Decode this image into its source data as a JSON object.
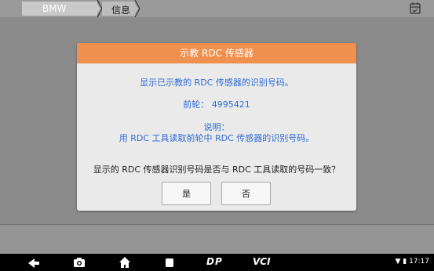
{
  "topbar": {
    "breadcrumb": [
      "BMW",
      "信息"
    ]
  },
  "dialog": {
    "title": "示教 RDC 传感器",
    "line1": "显示已示教的 RDC 传感器的识别号码。",
    "front_wheel": "前轮： 4995421",
    "explain_label": "说明：",
    "explain_text": "用 RDC 工具读取前轮中 RDC 传感器的识别号码。",
    "question": "显示的 RDC 传感器识别号码是否与 RDC 工具读取的号码一致？",
    "yes_label": "是",
    "no_label": "否"
  },
  "navbar": {
    "vci_label": "VCI",
    "dp_label": "DP",
    "time": "17:17"
  }
}
